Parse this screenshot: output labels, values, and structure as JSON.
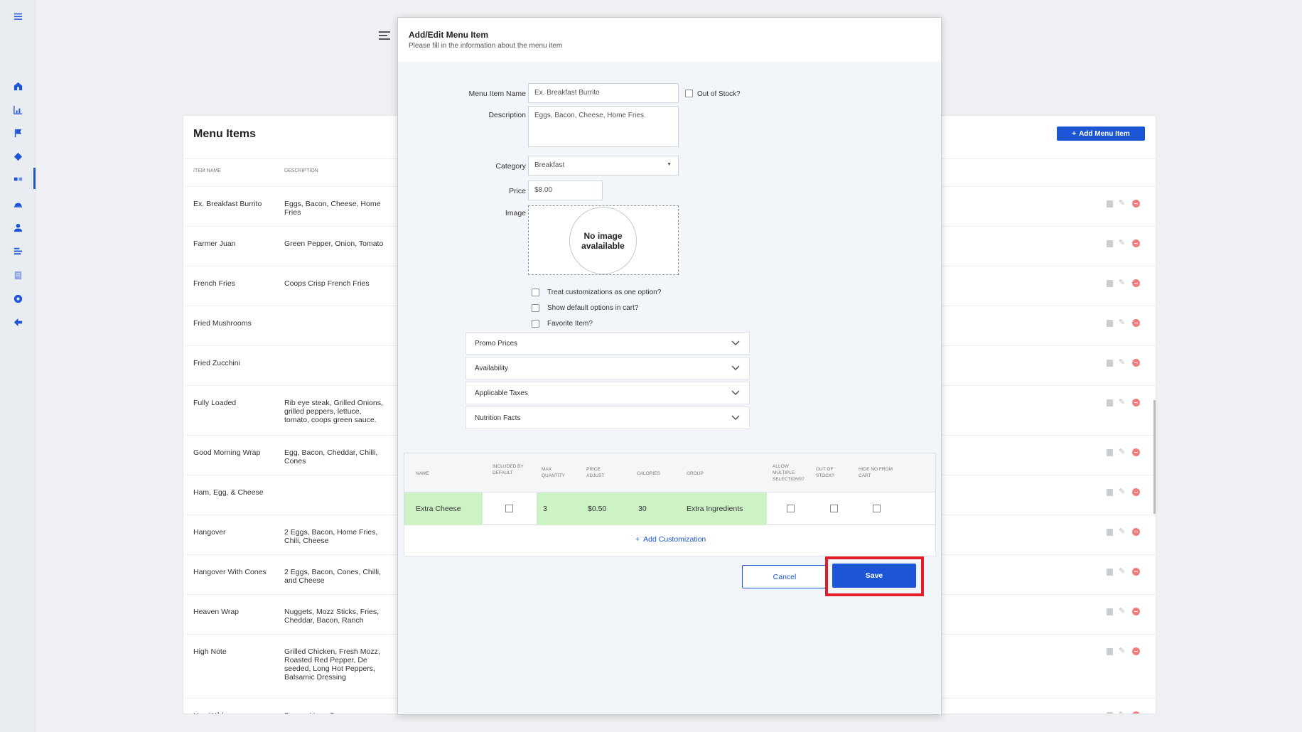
{
  "page": {
    "panel_title": "Menu Items",
    "add_menu_item_label": "Add Menu Item",
    "columns": {
      "item_name": "ITEM NAME",
      "description": "DESCRIPTION"
    },
    "rows": [
      {
        "name": "Ex. Breakfast Burrito",
        "description": "Eggs, Bacon, Cheese, Home Fries"
      },
      {
        "name": "Farmer Juan",
        "description": "Green Pepper, Onion, Tomato"
      },
      {
        "name": "French Fries",
        "description": "Coops Crisp French Fries"
      },
      {
        "name": "Fried Mushrooms",
        "description": ""
      },
      {
        "name": "Fried Zucchini",
        "description": ""
      },
      {
        "name": "Fully Loaded",
        "description": "Rib eye steak, Grilled Onions, grilled peppers, lettuce, tomato, coops green sauce."
      },
      {
        "name": "Good Morning Wrap",
        "description": "Egg, Bacon, Cheddar, Chilli, Cones"
      },
      {
        "name": "Ham, Egg, & Cheese",
        "description": ""
      },
      {
        "name": "Hangover",
        "description": "2 Eggs, Bacon, Home Fries, Chili, Cheese"
      },
      {
        "name": "Hangover With Cones",
        "description": "2 Eggs, Bacon, Cones, Chilli, and Cheese"
      },
      {
        "name": "Heaven Wrap",
        "description": "Nuggets, Mozz Sticks, Fries, Cheddar, Bacon, Ranch"
      },
      {
        "name": "High Note",
        "description": "Grilled Chicken, Fresh Mozz, Roasted Red Pepper, De seeded, Long Hot Peppers, Balsamic Dressing"
      },
      {
        "name": "Hog Wild",
        "description": "Bacon, Ham, Sausage, Cheese"
      }
    ]
  },
  "modal": {
    "title": "Add/Edit Menu Item",
    "subtitle": "Please fill in the information about the menu item",
    "fields": {
      "name_label": "Menu Item Name",
      "name_value": "Ex. Breakfast Burrito",
      "out_of_stock_label": "Out of Stock?",
      "description_label": "Description",
      "description_value": "Eggs, Bacon, Cheese, Home Fries",
      "category_label": "Category",
      "category_value": "Breakfast",
      "price_label": "Price",
      "price_value": "$8.00",
      "image_label": "Image",
      "no_image_text": "No image avalailable"
    },
    "checkboxes": [
      "Treat customizations as one option?",
      "Show default options in cart?",
      "Favorite Item?"
    ],
    "accordions": [
      "Promo Prices",
      "Availability",
      "Applicable Taxes",
      "Nutrition Facts"
    ],
    "customization_table": {
      "headers": {
        "name": "NAME",
        "included": "INCLUDED BY DEFAULT",
        "max_qty": "MAX QUANTITY",
        "price_adjust": "PRICE ADJUST",
        "calories": "CALORIES",
        "group": "GROUP",
        "allow_multiple": "ALLOW MULTIPLE SELECTIONS?",
        "out_of_stock": "OUT OF STOCK?",
        "hide_no": "HIDE NO FROM CART"
      },
      "row": {
        "name": "Extra Cheese",
        "max_qty": "3",
        "price_adjust": "$0.50",
        "calories": "30",
        "group": "Extra Ingredients"
      }
    },
    "add_customization_label": "Add Customization",
    "cancel_label": "Cancel",
    "save_label": "Save"
  },
  "colors": {
    "accent": "#1c55d6",
    "highlight": "#e11f2b",
    "row_green": "#cdf2c5",
    "delete": "#f27c7c"
  }
}
